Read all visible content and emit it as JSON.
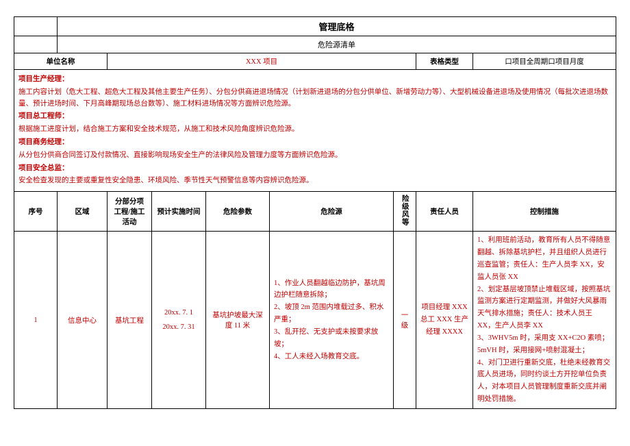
{
  "header": {
    "title": "管理底格",
    "subtitle": "危险源清单"
  },
  "meta": {
    "unit_label": "单位名称",
    "unit_value": "XXX 项目",
    "type_label": "表格类型",
    "type_value": "口项目全周期口项目月度"
  },
  "roles": {
    "prod_mgr_title": "项目生产经理：",
    "prod_mgr_body": "施工内容计划（危大工程、超危大工程及其他主要生产任务）、分包分供商进退场情况（计划新进退场的分包分供单位、新增劳动力等）、大型机械设备进退场及使用情况（每批次进退场数量、预计进场时间、下月高峰期现场总台数等）、施工材料进场情况等方面辨识危险源。",
    "chief_eng_title": "项目总工程师：",
    "chief_eng_body": "根据施工进度计划，结合施工方案和安全技术规范，从施工和技术风险角度辨识危险源。",
    "biz_mgr_title": "项目商务经理：",
    "biz_mgr_body": "从分包分供商合同签订及付款情况、直接影响现场安全生产的法律风险及管理力度等方面辨识危险源。",
    "safety_title": "项目安全总监：",
    "safety_body": "安全检查发现的主要或重复性安全隐患、环境风险、季节性天气预警信息等内容辨识危险源。"
  },
  "columns": {
    "seq": "序号",
    "area": "区域",
    "activity": "分部分项工程/施工活动",
    "time": "预计实施时间",
    "param": "危险参数",
    "source": "危险源",
    "grade": "险级风等",
    "responsible": "责任人员",
    "control": "控制措施"
  },
  "row1": {
    "seq": "1",
    "area": "信息中心",
    "activity": "基坑工程",
    "time1": "20xx. 7. 1",
    "time2": "20xx. 7. 31",
    "param": "基坑护坡最大深度 11 米",
    "source": "1、作业人员翻越临边防护，基坑周边护栏随意拆除；\n2、坡顶 2m 范围内堆载过多、积水严重；\n3、乱开挖、无支护或未按要求放坡；\n4、工人未经入场教育交底。",
    "grade": "一级",
    "responsible": "项目经理 XXX 总工 XXX 生产经理 XXXX",
    "control": "1、利用班前活动，教育所有人员不得随意翻越、拆除基坑护栏，并且组织人员进行巡查监管；责任人：生产人员李 XX，安监人员张 XX\n2、划定基层坡顶禁止堆载区域，按照基坑监测方案进行定期监测，并做好大风暴雨天气排水措施；责任人：技术人员王 XX，生产人员李 XX\n3、3WHV5m 时，采用支 XX+C2O 素喷；5mVH 时，采用接网+喷射混凝土；\n4、对门卫进行重新交底，杜绝未经教育交底人员进场，同时约谈土方开挖单位负责人，对本项目人员管理制度重新交底并阐明处罚措施。"
  }
}
